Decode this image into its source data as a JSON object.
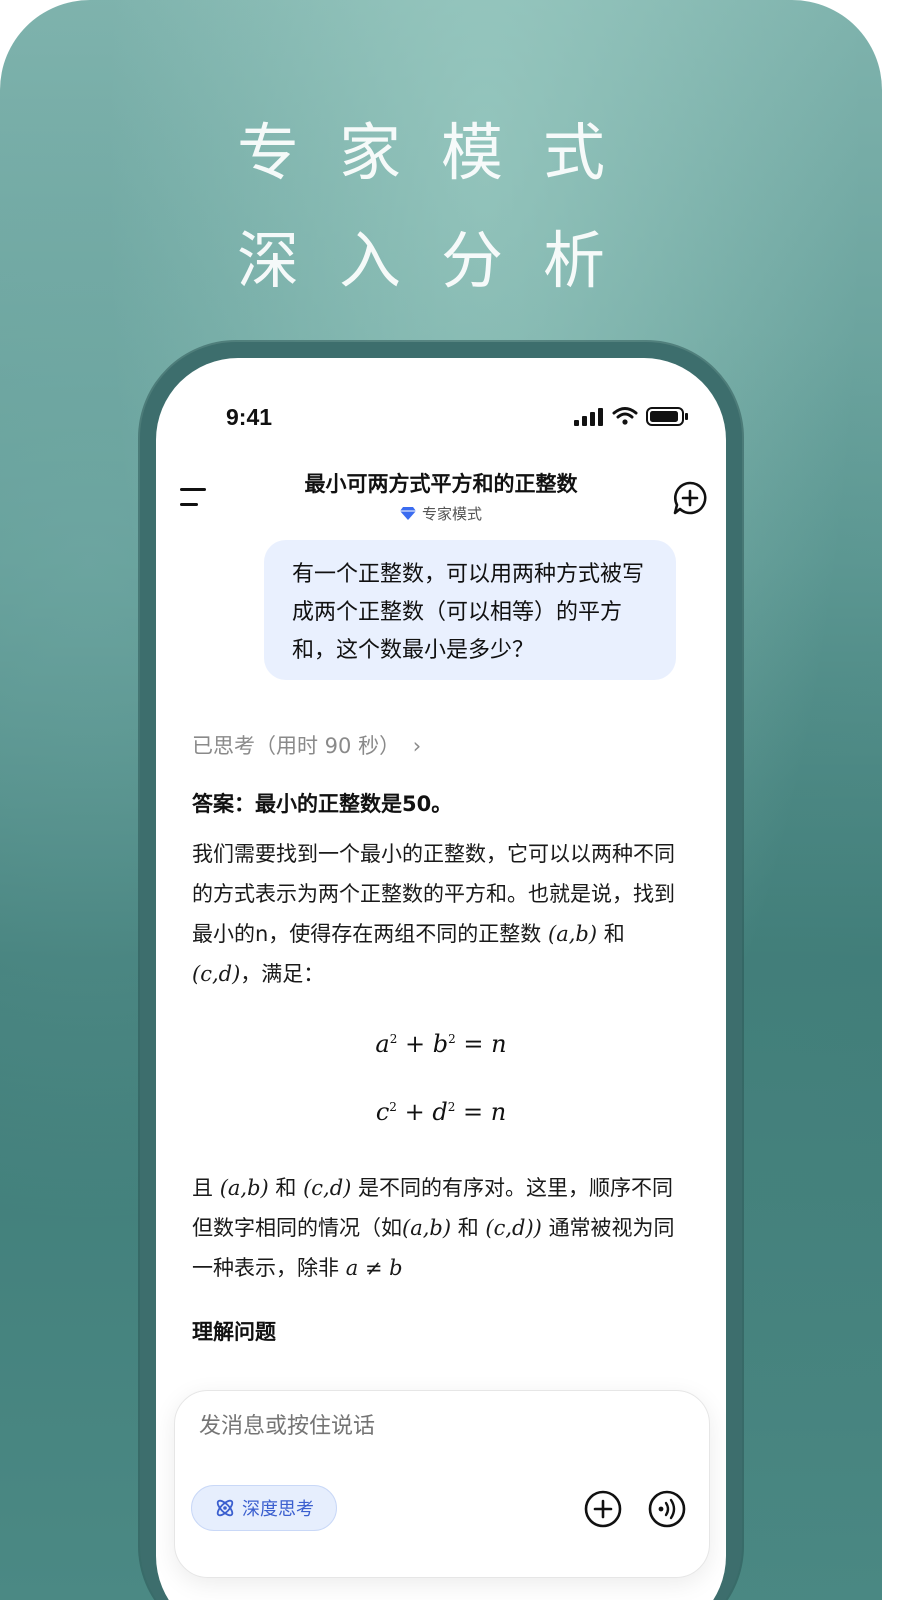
{
  "banner": {
    "line1": "专家模式",
    "line2": "深入分析"
  },
  "status_bar": {
    "time": "9:41"
  },
  "nav": {
    "title": "最小可两方式平方和的正整数",
    "mode": "专家模式"
  },
  "user_message": "有一个正整数，可以用两种方式被写成两个正整数（可以相等）的平方和，这个数最小是多少？",
  "response": {
    "thought_label": "已思考（用时 90 秒）",
    "answer_heading": "答案：最小的正整数是50。",
    "para1": {
      "text": "我们需要找到一个最小的正整数，它可以以两种不同的方式表示为两个正整数的平方和。也就是说，找到最小的n，使得存在两组不同的正整数",
      "m1": "(a,b)",
      "join": "和",
      "m2": "(c,d)",
      "tail": "，满足："
    },
    "eq1": {
      "a": "a",
      "b": "b",
      "rhs": "= n"
    },
    "eq2": {
      "a": "c",
      "b": "d",
      "rhs": "= n"
    },
    "para2": {
      "p1": "且",
      "m1": "(a,b)",
      "p2": "和",
      "m2": "(c,d)",
      "p3": "是不同的有序对。这里，顺序不同但数字相同的情况（如",
      "m3": "(a,b)",
      "p4": "和",
      "m4": "(c,d))",
      "p5": "通常被视为同一种表示，除非",
      "m5": "a ≠ b"
    },
    "section_heading": "理解问题"
  },
  "composer": {
    "placeholder": "发消息或按住说话",
    "deep_think_label": "深度思考"
  },
  "colors": {
    "bubble": "#e9f0fe",
    "accent": "#3b5fcf",
    "background": "#5f9a95"
  }
}
